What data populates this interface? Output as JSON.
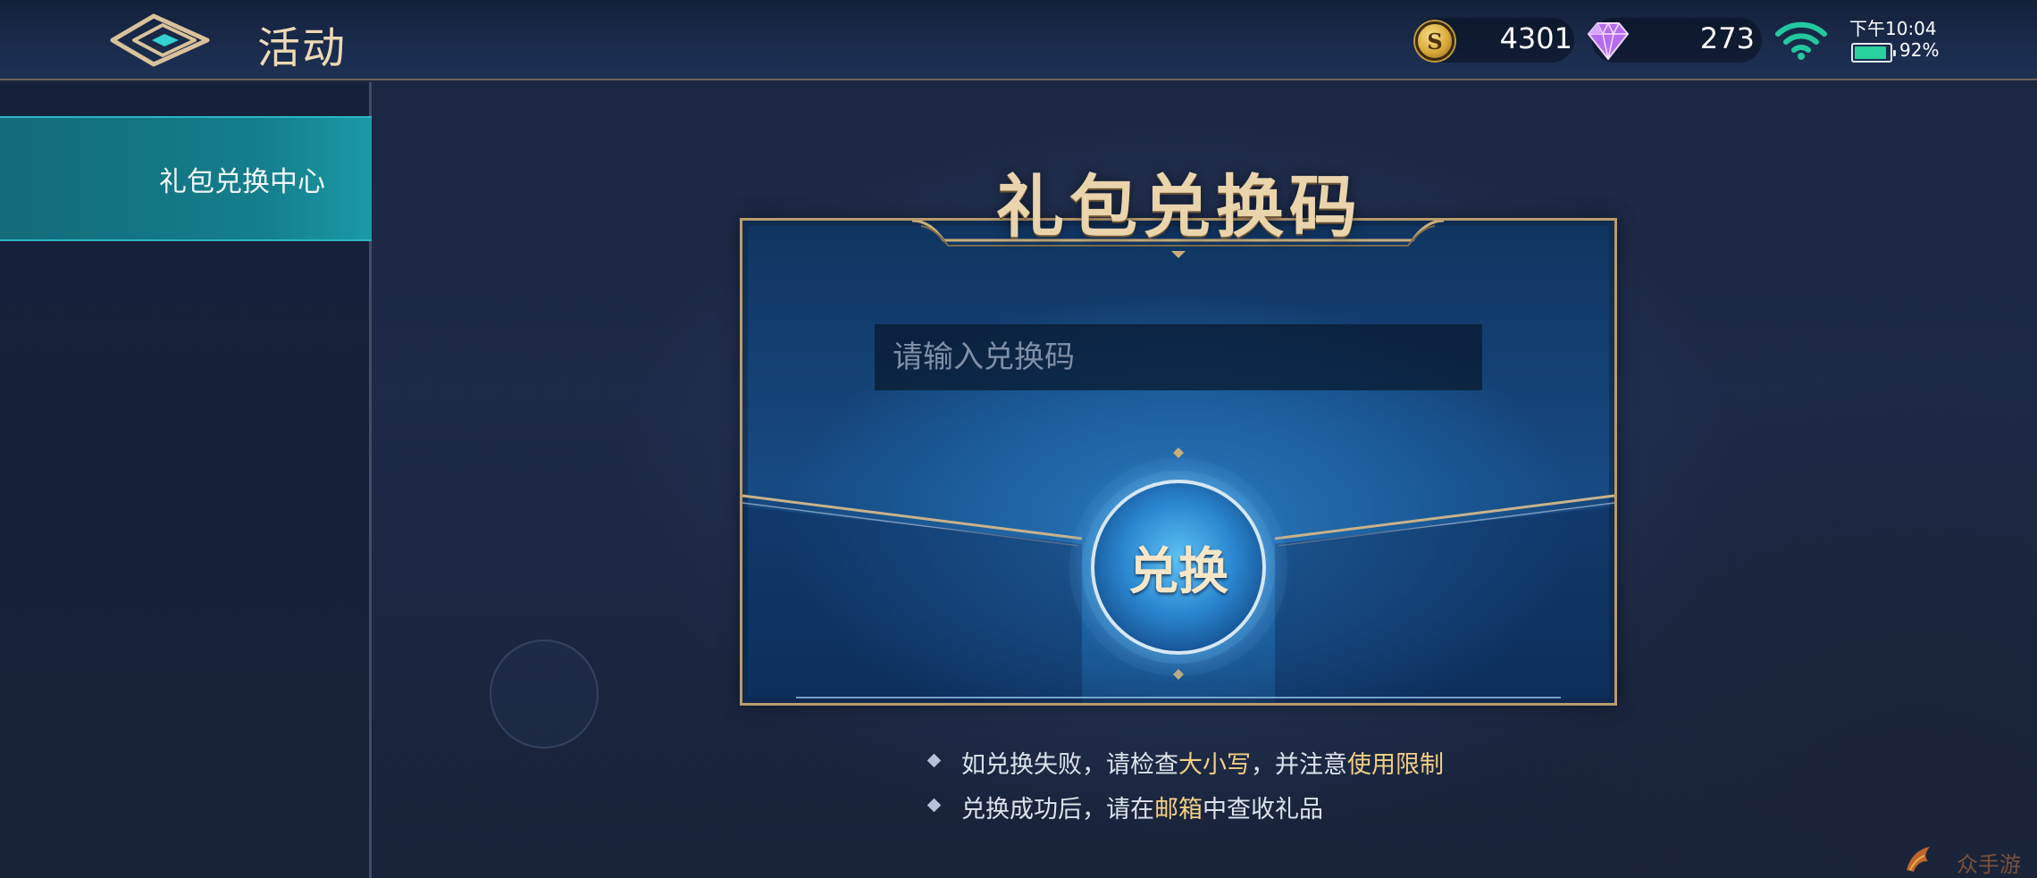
{
  "header": {
    "back_icon": "back-arrow-icon",
    "title": "活动",
    "coins": "4301",
    "coin_icon": "coin-icon",
    "coin_symbol": "S",
    "gems": "273",
    "gem_icon": "diamond-gem-icon",
    "wifi_icon": "wifi-icon",
    "time": "下午10:04",
    "battery_icon": "battery-icon",
    "battery_percent": "92%",
    "battery_level": 0.92
  },
  "sidebar": {
    "items": [
      {
        "label": "礼包兑换中心",
        "active": true
      }
    ]
  },
  "redeem": {
    "title": "礼包兑换码",
    "input_value": "",
    "input_placeholder": "请输入兑换码",
    "button_label": "兑换"
  },
  "tips": [
    {
      "parts": [
        {
          "text": "如兑换失败，请检查",
          "highlight": false
        },
        {
          "text": "大小写",
          "highlight": true
        },
        {
          "text": "，并注意",
          "highlight": false
        },
        {
          "text": "使用限制",
          "highlight": true
        }
      ]
    },
    {
      "parts": [
        {
          "text": "兑换成功后，请在",
          "highlight": false
        },
        {
          "text": "邮箱",
          "highlight": true
        },
        {
          "text": "中查收礼品",
          "highlight": false
        }
      ]
    }
  ],
  "watermark": {
    "logo_icon": "watermark-logo-icon",
    "text": "众手游网"
  },
  "colors": {
    "accent_gold": "#e9d4ac",
    "highlight": "#f1cf84",
    "sidebar_active": "#147e8c",
    "wifi": "#22c9a0",
    "battery": "#28d19e"
  }
}
